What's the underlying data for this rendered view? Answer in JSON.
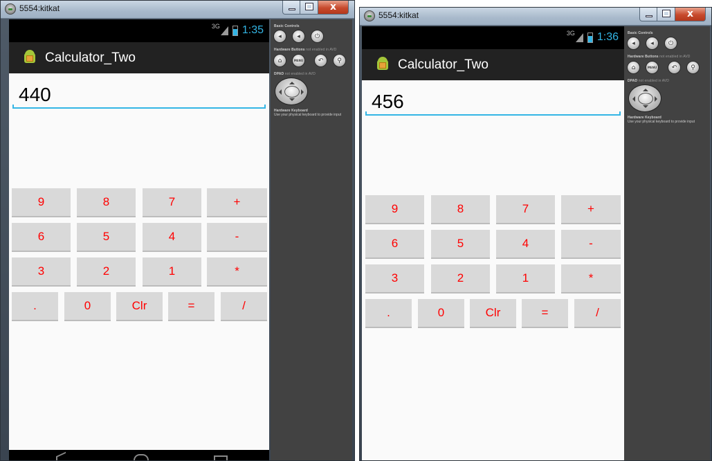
{
  "windows": [
    {
      "title": "5554:kitkat",
      "status": {
        "network": "3G",
        "time": "1:35"
      },
      "app_title": "Calculator_Two",
      "display_value": "440",
      "keypad": {
        "row1": [
          "9",
          "8",
          "7",
          "+"
        ],
        "row2": [
          "6",
          "5",
          "4",
          "-"
        ],
        "row3": [
          "3",
          "2",
          "1",
          "*"
        ],
        "row4": [
          ".",
          "0",
          "Clr",
          "=",
          "/"
        ]
      },
      "panel": {
        "basic_controls": "Basic Controls",
        "hardware_buttons": "Hardware Buttons",
        "hardware_buttons_note": "not enabled in AVD",
        "menu": "MENU",
        "dpad": "DPAD",
        "dpad_note": "not enabled in AVD",
        "keyboard": "Hardware Keyboard",
        "keyboard_note": "Use your physical keyboard to provide input"
      }
    },
    {
      "title": "5554:kitkat",
      "status": {
        "network": "3G",
        "time": "1:36"
      },
      "app_title": "Calculator_Two",
      "display_value": "456",
      "keypad": {
        "row1": [
          "9",
          "8",
          "7",
          "+"
        ],
        "row2": [
          "6",
          "5",
          "4",
          "-"
        ],
        "row3": [
          "3",
          "2",
          "1",
          "*"
        ],
        "row4": [
          ".",
          "0",
          "Clr",
          "=",
          "/"
        ]
      },
      "panel": {
        "basic_controls": "Basic Controls",
        "hardware_buttons": "Hardware Buttons",
        "hardware_buttons_note": "not enabled in AVD",
        "menu": "MENU",
        "dpad": "DPAD",
        "dpad_note": "not enabled in AVD",
        "keyboard": "Hardware Keyboard",
        "keyboard_note": "Use your physical keyboard to provide input"
      }
    }
  ],
  "colors": {
    "accent": "#33b5e5",
    "key_text": "#ff0000",
    "key_bg": "#d9d9d9",
    "action_bar": "#222222",
    "panel_bg": "#424242"
  },
  "icons": {
    "title_icon": "android-emulator-icon",
    "app_icon": "android-robot-icon",
    "panel": [
      "volume-down-icon",
      "volume-up-icon",
      "power-icon",
      "home-icon",
      "menu-icon",
      "back-icon",
      "search-icon",
      "dpad-icon"
    ],
    "nav": [
      "back-icon",
      "home-icon",
      "recent-apps-icon"
    ]
  }
}
